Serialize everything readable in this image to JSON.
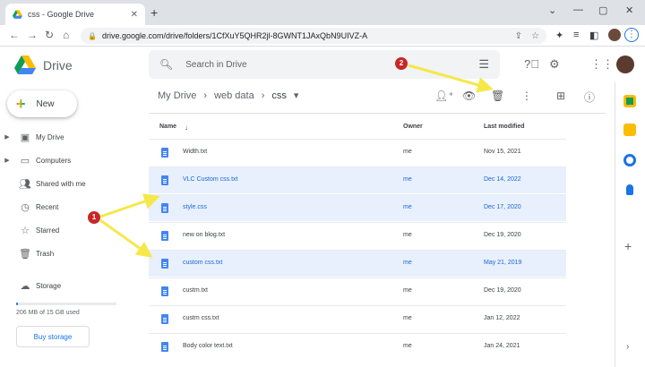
{
  "browser": {
    "tab_title": "css - Google Drive",
    "new_tab": "+",
    "url": "drive.google.com/drive/folders/1CfXuY5QHR2jl-8GWNT1JAxQbN9UIVZ-A",
    "window_controls": [
      "⌄",
      "—",
      "▢",
      "✕"
    ]
  },
  "header": {
    "app_name": "Drive",
    "search_placeholder": "Search in Drive"
  },
  "sidebar": {
    "new_label": "New",
    "items": [
      {
        "label": "My Drive",
        "icon": "my-drive-icon"
      },
      {
        "label": "Computers",
        "icon": "computers-icon"
      },
      {
        "label": "Shared with me",
        "icon": "shared-icon"
      },
      {
        "label": "Recent",
        "icon": "recent-icon"
      },
      {
        "label": "Starred",
        "icon": "star-icon"
      },
      {
        "label": "Trash",
        "icon": "trash-icon"
      }
    ],
    "storage_label": "Storage",
    "storage_used": "206 MB of 15 GB used",
    "storage_fraction": 0.013,
    "buy_label": "Buy storage"
  },
  "breadcrumb": {
    "root": "My Drive",
    "middle": "web data",
    "current": "css"
  },
  "table": {
    "headers": {
      "name": "Name",
      "owner": "Owner",
      "modified": "Last modified"
    },
    "rows": [
      {
        "name": "Width.txt",
        "owner": "me",
        "modified": "Nov 15, 2021",
        "selected": false
      },
      {
        "name": "VLC Custom css.txt",
        "owner": "me",
        "modified": "Dec 14, 2022",
        "selected": true
      },
      {
        "name": "style.css",
        "owner": "me",
        "modified": "Dec 17, 2020",
        "selected": true
      },
      {
        "name": "new on blog.txt",
        "owner": "me",
        "modified": "Dec 19, 2020",
        "selected": false
      },
      {
        "name": "custom css.txt",
        "owner": "me",
        "modified": "May 21, 2019",
        "selected": true
      },
      {
        "name": "custm.txt",
        "owner": "me",
        "modified": "Dec 19, 2020",
        "selected": false
      },
      {
        "name": "custm css.txt",
        "owner": "me",
        "modified": "Jan 12, 2022",
        "selected": false
      },
      {
        "name": "Body color text.txt",
        "owner": "me",
        "modified": "Jan 24, 2021",
        "selected": false
      }
    ]
  },
  "annotations": {
    "badge1": "1",
    "badge2": "2"
  },
  "colors": {
    "accent": "#1a73e8",
    "selected_row": "#e8f0fe",
    "arrow": "#f5e84a",
    "badge": "#c62828"
  }
}
